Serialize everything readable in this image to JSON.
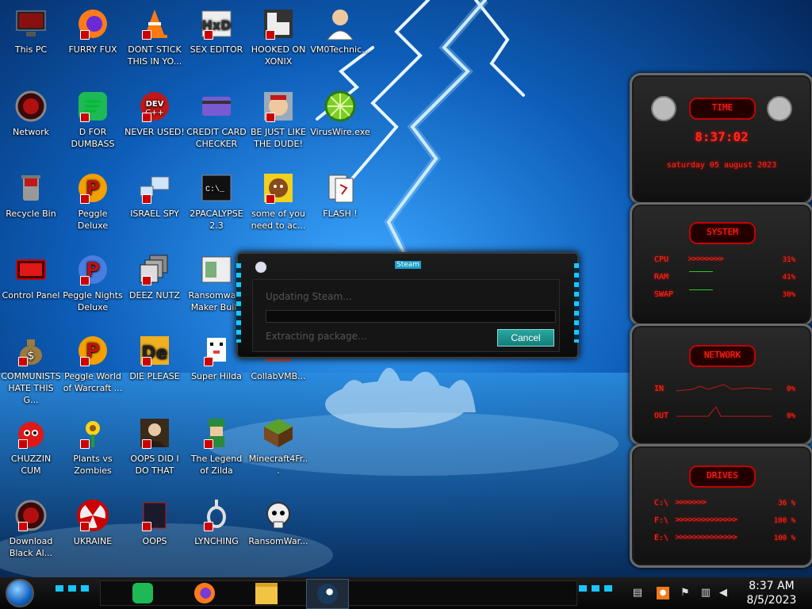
{
  "desktop": {
    "icons": [
      {
        "label": "This PC"
      },
      {
        "label": "FURRY FUX"
      },
      {
        "label": "DONT STICK THIS IN YO..."
      },
      {
        "label": "SEX EDITOR"
      },
      {
        "label": "HOOKED ON XONIX"
      },
      {
        "label": "VM0Technic..."
      },
      {
        "label": "Network"
      },
      {
        "label": "D FOR DUMBASS"
      },
      {
        "label": "NEVER USED!"
      },
      {
        "label": "CREDIT CARD CHECKER"
      },
      {
        "label": "BE JUST LIKE THE DUDE!"
      },
      {
        "label": "VirusWire.exe"
      },
      {
        "label": "Recycle Bin"
      },
      {
        "label": "Peggle Deluxe"
      },
      {
        "label": "ISRAEL SPY"
      },
      {
        "label": "2PACALYPSE 2.3"
      },
      {
        "label": "some of you need to ac..."
      },
      {
        "label": "FLASH !"
      },
      {
        "label": "Control Panel"
      },
      {
        "label": "Peggle Nights Deluxe"
      },
      {
        "label": "DEEZ NUTZ"
      },
      {
        "label": "Ransomware Maker Build"
      },
      {
        "label": "COMMUNISTS HATE THIS G..."
      },
      {
        "label": "Peggle World of Warcraft ..."
      },
      {
        "label": "DIE PLEASE"
      },
      {
        "label": "Super Hilda"
      },
      {
        "label": "CollabVMB..."
      },
      {
        "label": "CHUZZIN CUM"
      },
      {
        "label": "Plants vs Zombies"
      },
      {
        "label": "OOPS DID I DO THAT"
      },
      {
        "label": "The Legend of Zilda"
      },
      {
        "label": "Minecraft4Fr..."
      },
      {
        "label": "Download Black Al..."
      },
      {
        "label": "UKRAINE"
      },
      {
        "label": "OOPS"
      },
      {
        "label": "LYNCHING"
      },
      {
        "label": "RansomWar..."
      }
    ]
  },
  "dialog": {
    "title": "Steam",
    "status": "Updating Steam...",
    "detail": "Extracting package...",
    "cancel_label": "Cancel",
    "progress": 0
  },
  "widgets": {
    "time": {
      "heading": "TIME",
      "clock": "8:37:02",
      "date": "saturday 05 august 2023"
    },
    "system": {
      "heading": "SYSTEM",
      "rows": [
        {
          "label": "CPU",
          "value": "31%"
        },
        {
          "label": "RAM",
          "value": "41%"
        },
        {
          "label": "SWAP",
          "value": "30%"
        }
      ]
    },
    "network": {
      "heading": "NETWORK",
      "rows": [
        {
          "label": "IN",
          "value": "0%"
        },
        {
          "label": "OUT",
          "value": "0%"
        }
      ]
    },
    "drives": {
      "heading": "DRIVES",
      "rows": [
        {
          "label": "C:\\",
          "value": "36 %"
        },
        {
          "label": "F:\\",
          "value": "100 %"
        },
        {
          "label": "E:\\",
          "value": "100 %"
        }
      ]
    }
  },
  "taskbar": {
    "clock_time": "8:37 AM",
    "clock_date": "8/5/2023"
  }
}
